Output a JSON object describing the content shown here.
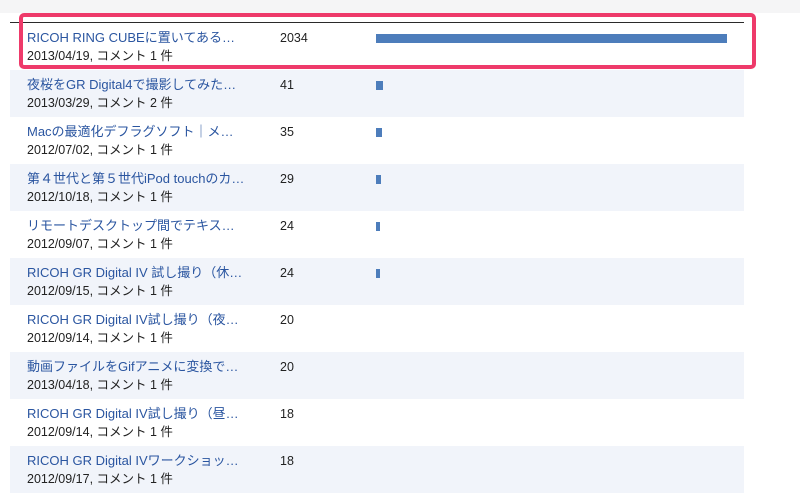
{
  "rows": [
    {
      "title": "RICOH RING CUBEに置いてある…",
      "date": "2013/04/19",
      "comments": "コメント 1 件",
      "count": "2034"
    },
    {
      "title": "夜桜をGR Digital4で撮影してみた…",
      "date": "2013/03/29",
      "comments": "コメント 2 件",
      "count": "41"
    },
    {
      "title": "Macの最適化デフラグソフト｜メ…",
      "date": "2012/07/02",
      "comments": "コメント 1 件",
      "count": "35"
    },
    {
      "title": "第４世代と第５世代iPod touchのカ…",
      "date": "2012/10/18",
      "comments": "コメント 1 件",
      "count": "29"
    },
    {
      "title": "リモートデスクトップ間でテキス…",
      "date": "2012/09/07",
      "comments": "コメント 1 件",
      "count": "24"
    },
    {
      "title": "RICOH GR Digital IV 試し撮り（休…",
      "date": "2012/09/15",
      "comments": "コメント 1 件",
      "count": "24"
    },
    {
      "title": "RICOH GR Digital IV試し撮り（夜…",
      "date": "2012/09/14",
      "comments": "コメント 1 件",
      "count": "20"
    },
    {
      "title": "動画ファイルをGifアニメに変換で…",
      "date": "2013/04/18",
      "comments": "コメント 1 件",
      "count": "20"
    },
    {
      "title": "RICOH GR Digital IV試し撮り（昼…",
      "date": "2012/09/14",
      "comments": "コメント 1 件",
      "count": "18"
    },
    {
      "title": "RICOH GR Digital IVワークショッ…",
      "date": "2012/09/17",
      "comments": "コメント 1 件",
      "count": "18"
    }
  ],
  "bars": {
    "max": 2034,
    "visible_for": [
      2034,
      41,
      35,
      29,
      24,
      24
    ],
    "color": "#4d7dbb"
  },
  "highlight_color": "#ee3a6a",
  "row_alt_color": "#f1f4fa"
}
